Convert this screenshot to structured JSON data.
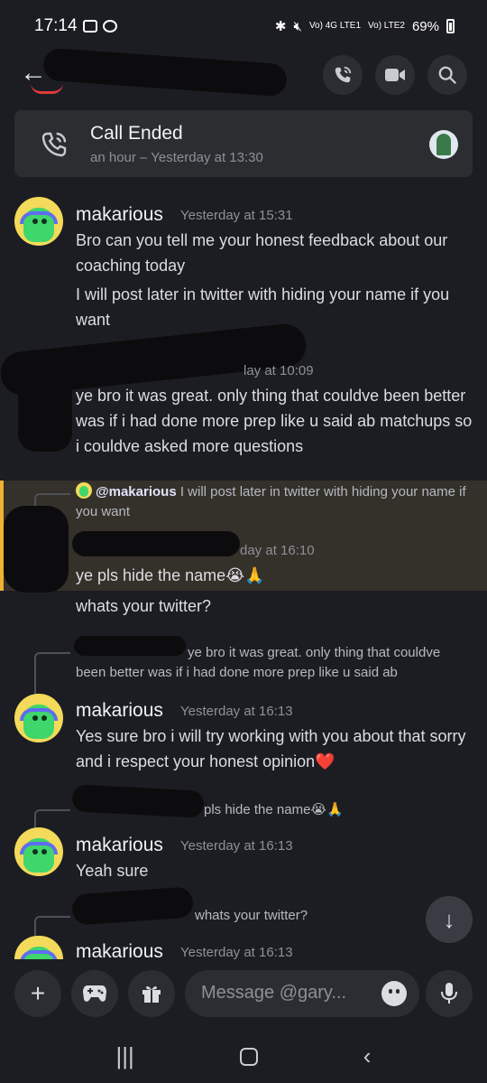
{
  "status_bar": {
    "time": "17:14",
    "battery": "69%",
    "net1": "Vo) 4G LTE1",
    "net2": "Vo) LTE2"
  },
  "call": {
    "title": "Call Ended",
    "subtitle": "an hour – Yesterday at 13:30"
  },
  "messages": [
    {
      "author": "makarious",
      "timestamp": "Yesterday at 15:31",
      "lines": [
        "Bro can you tell me your honest feedback about our coaching today",
        "I will post later in twitter with hiding your name if you want"
      ]
    },
    {
      "timestamp_partial": "lay at 10:09",
      "text": "ye bro it was great. only thing that couldve been better was if i had done more prep like u said ab matchups so i couldve asked more questions"
    },
    {
      "reply_mention": "@makarious",
      "reply_text": "I will post later in twitter with hiding your name if you want",
      "timestamp_partial": "day at 16:10",
      "lines": [
        "ye pls hide the name😭🙏",
        "whats your twitter?"
      ]
    },
    {
      "reply_text": "ye bro it was great. only thing that couldve been better was if i had done more prep like u said ab",
      "author": "makarious",
      "timestamp": "Yesterday at 16:13",
      "text": "Yes sure bro i will try working with you about that sorry and i respect your honest opinion",
      "emoji": "❤️"
    },
    {
      "reply_text": "pls hide the name😭🙏",
      "author": "makarious",
      "timestamp": "Yesterday at 16:13",
      "text": "Yeah sure"
    },
    {
      "reply_text": "whats your twitter?",
      "author": "makarious",
      "timestamp": "Yesterday at 16:13"
    }
  ],
  "composer": {
    "placeholder": "Message @gary..."
  },
  "icons": {
    "back": "back-arrow-icon",
    "voice_call": "phone-call-icon",
    "video": "video-camera-icon",
    "search": "search-icon",
    "add": "plus-icon",
    "games": "gamepad-icon",
    "gift": "gift-icon",
    "emoji": "emoji-icon",
    "mic": "microphone-icon",
    "scroll_down": "arrow-down-icon"
  },
  "colors": {
    "background": "#1c1d22",
    "card": "#2b2d31",
    "highlight": "#34302a",
    "highlight_bar": "#f0b232",
    "muted_text": "#8e9097"
  }
}
